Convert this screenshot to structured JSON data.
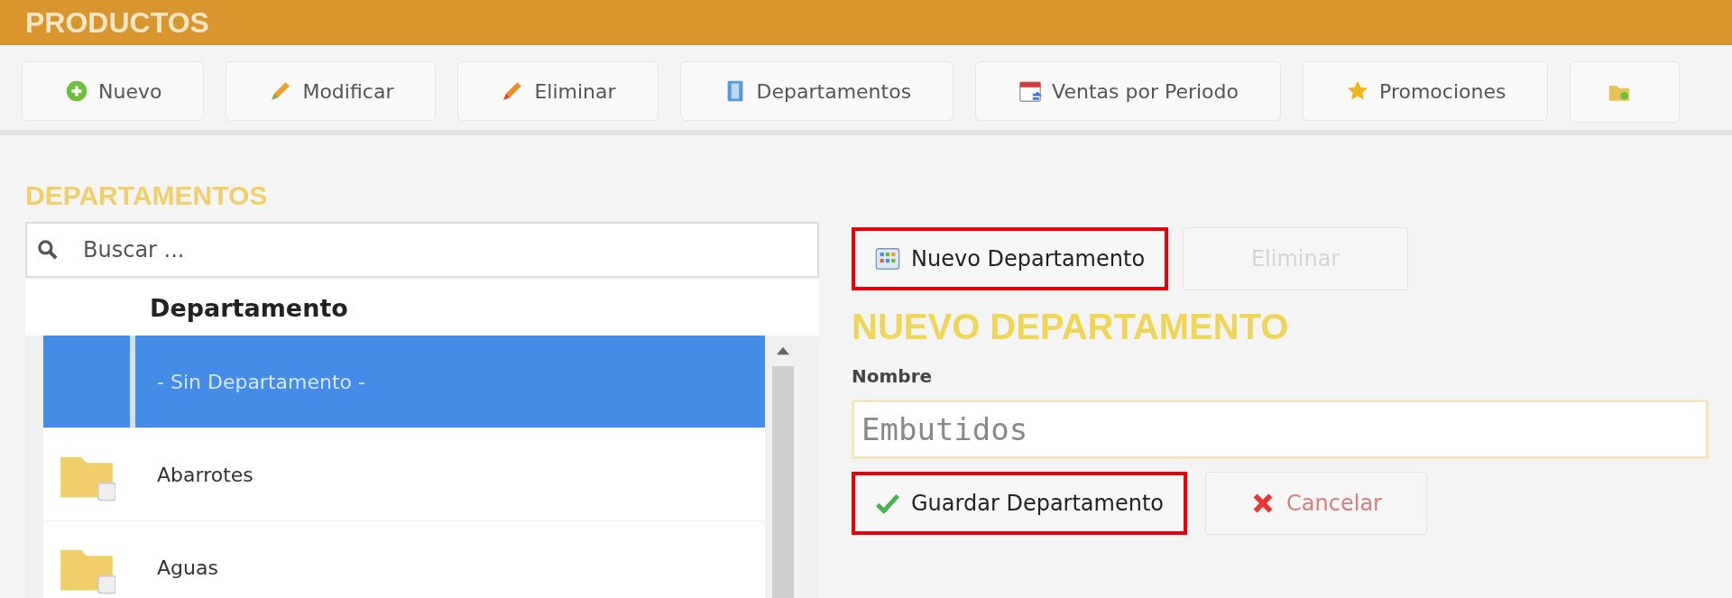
{
  "header": {
    "title": "PRODUCTOS"
  },
  "toolbar": [
    {
      "label": "Nuevo"
    },
    {
      "label": "Modificar"
    },
    {
      "label": "Eliminar"
    },
    {
      "label": "Departamentos"
    },
    {
      "label": "Ventas por Periodo"
    },
    {
      "label": "Promociones"
    }
  ],
  "departments": {
    "heading": "DEPARTAMENTOS",
    "search": {
      "placeholder": "Buscar ..."
    },
    "column": "Departamento",
    "rows": [
      {
        "name": "- Sin Departamento -",
        "selected": true
      },
      {
        "name": "Abarrotes",
        "selected": false
      },
      {
        "name": "Aguas",
        "selected": false
      }
    ]
  },
  "actions": [
    {
      "label": "Nuevo Departamento",
      "highlighted": true,
      "disabled": false
    },
    {
      "label": "Eliminar",
      "highlighted": false,
      "disabled": true
    }
  ],
  "form": {
    "heading": "NUEVO DEPARTAMENTO",
    "label": "Nombre",
    "value": "Embutidos",
    "buttons": [
      {
        "label": "Guardar Departamento",
        "kind": "save",
        "highlighted": true
      },
      {
        "label": "Cancelar",
        "kind": "cancel",
        "highlighted": false
      }
    ]
  }
}
